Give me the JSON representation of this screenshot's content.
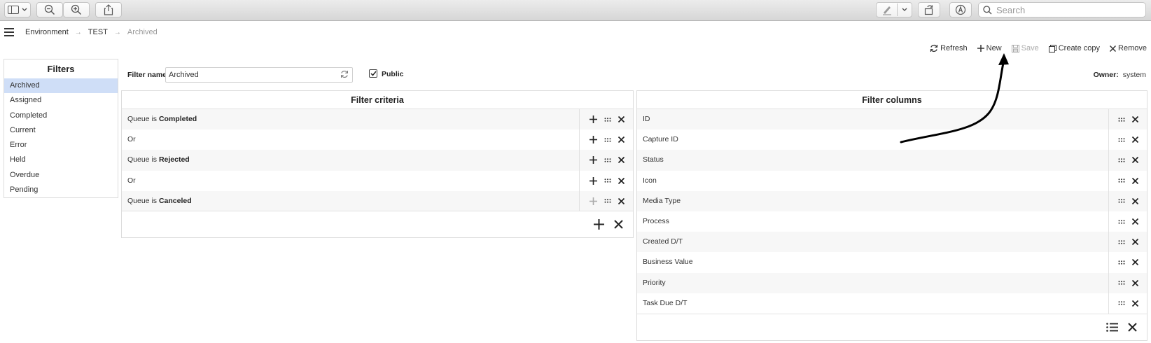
{
  "toolbar": {
    "search_placeholder": "Search",
    "icons": [
      "sidebar-icon",
      "chevron-down-icon",
      "zoom-out-icon",
      "zoom-in-icon",
      "share-icon",
      "markup-pen-icon",
      "rotate-icon",
      "annotate-icon",
      "search-icon"
    ]
  },
  "breadcrumb": {
    "items": [
      "Environment",
      "TEST",
      "Archived"
    ]
  },
  "actions": {
    "refresh": "Refresh",
    "new": "New",
    "save": "Save",
    "create_copy": "Create copy",
    "remove": "Remove"
  },
  "filters": {
    "title": "Filters",
    "items": [
      "Archived",
      "Assigned",
      "Completed",
      "Current",
      "Error",
      "Held",
      "Overdue",
      "Pending"
    ],
    "selected": "Archived"
  },
  "filter_form": {
    "name_label": "Filter name",
    "name_value": "Archived",
    "public_label": "Public",
    "public_checked": true,
    "owner_label": "Owner:",
    "owner_value": "system"
  },
  "criteria": {
    "title": "Filter criteria",
    "rows": [
      {
        "prefix": "Queue is ",
        "value": "Completed"
      },
      {
        "prefix": "Or",
        "value": ""
      },
      {
        "prefix": "Queue is ",
        "value": "Rejected"
      },
      {
        "prefix": "Or",
        "value": ""
      },
      {
        "prefix": "Queue is ",
        "value": "Canceled"
      }
    ]
  },
  "columns": {
    "title": "Filter columns",
    "rows": [
      "ID",
      "Capture ID",
      "Status",
      "Icon",
      "Media Type",
      "Process",
      "Created D/T",
      "Business Value",
      "Priority",
      "Task Due D/T"
    ]
  },
  "colors": {
    "selected_row": "#cfdef7",
    "text": "#333333",
    "disabled": "#aaaaaa"
  }
}
